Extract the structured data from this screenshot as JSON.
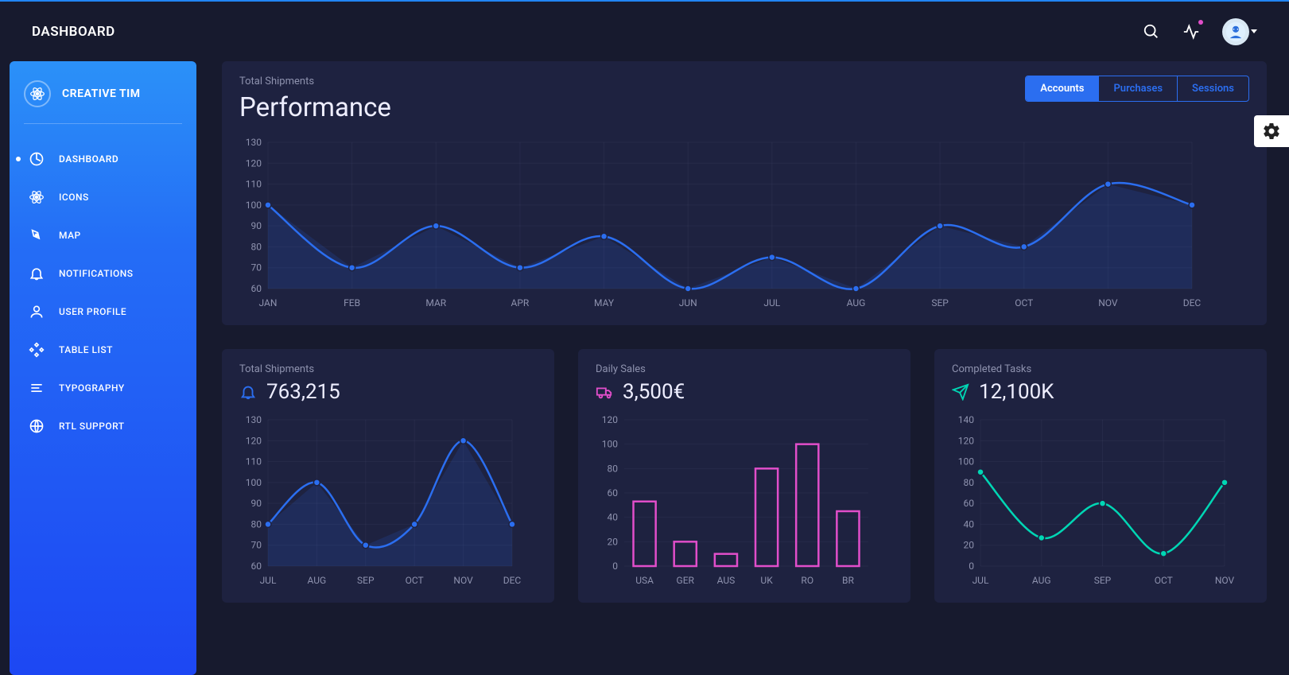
{
  "topbar": {
    "title": "DASHBOARD"
  },
  "sidebar": {
    "brand": "CREATIVE TIM",
    "items": [
      {
        "label": "DASHBOARD",
        "active": true
      },
      {
        "label": "ICONS",
        "active": false
      },
      {
        "label": "MAP",
        "active": false
      },
      {
        "label": "NOTIFICATIONS",
        "active": false
      },
      {
        "label": "USER PROFILE",
        "active": false
      },
      {
        "label": "TABLE LIST",
        "active": false
      },
      {
        "label": "TYPOGRAPHY",
        "active": false
      },
      {
        "label": "RTL SUPPORT",
        "active": false
      }
    ]
  },
  "main_chart": {
    "subtitle": "Total Shipments",
    "title": "Performance",
    "tabs": [
      {
        "label": "Accounts",
        "active": true
      },
      {
        "label": "Purchases",
        "active": false
      },
      {
        "label": "Sessions",
        "active": false
      }
    ]
  },
  "card1": {
    "subtitle": "Total Shipments",
    "value": "763,215"
  },
  "card2": {
    "subtitle": "Daily Sales",
    "value": "3,500€"
  },
  "card3": {
    "subtitle": "Completed Tasks",
    "value": "12,100K"
  },
  "chart_data": [
    {
      "id": "main_performance",
      "type": "line",
      "title": "Performance — Total Shipments",
      "categories": [
        "JAN",
        "FEB",
        "MAR",
        "APR",
        "MAY",
        "JUN",
        "JUL",
        "AUG",
        "SEP",
        "OCT",
        "NOV",
        "DEC"
      ],
      "values": [
        100,
        70,
        90,
        70,
        85,
        60,
        75,
        60,
        90,
        80,
        110,
        100
      ],
      "ylim": [
        60,
        130
      ],
      "yticks": [
        60,
        70,
        80,
        90,
        100,
        110,
        120,
        130
      ],
      "line_color": "#2b6ef0",
      "fill_color": "rgba(43,110,240,0.15)"
    },
    {
      "id": "total_shipments",
      "type": "line",
      "title": "Total Shipments",
      "categories": [
        "JUL",
        "AUG",
        "SEP",
        "OCT",
        "NOV",
        "DEC"
      ],
      "values": [
        80,
        100,
        70,
        80,
        120,
        80
      ],
      "ylim": [
        60,
        130
      ],
      "yticks": [
        60,
        70,
        80,
        90,
        100,
        110,
        120,
        130
      ],
      "line_color": "#2b6ef0",
      "fill_color": "rgba(43,110,240,0.15)"
    },
    {
      "id": "daily_sales",
      "type": "bar",
      "title": "Daily Sales",
      "categories": [
        "USA",
        "GER",
        "AUS",
        "UK",
        "RO",
        "BR"
      ],
      "values": [
        53,
        20,
        10,
        80,
        100,
        45
      ],
      "ylim": [
        0,
        120
      ],
      "yticks": [
        0,
        20,
        40,
        60,
        80,
        100,
        120
      ],
      "bar_color": "#e14eca"
    },
    {
      "id": "completed_tasks",
      "type": "line",
      "title": "Completed Tasks",
      "categories": [
        "JUL",
        "AUG",
        "SEP",
        "OCT",
        "NOV"
      ],
      "values": [
        90,
        27,
        60,
        12,
        80
      ],
      "ylim": [
        0,
        140
      ],
      "yticks": [
        0,
        20,
        40,
        60,
        80,
        100,
        120,
        140
      ],
      "line_color": "#00d6b4"
    }
  ]
}
